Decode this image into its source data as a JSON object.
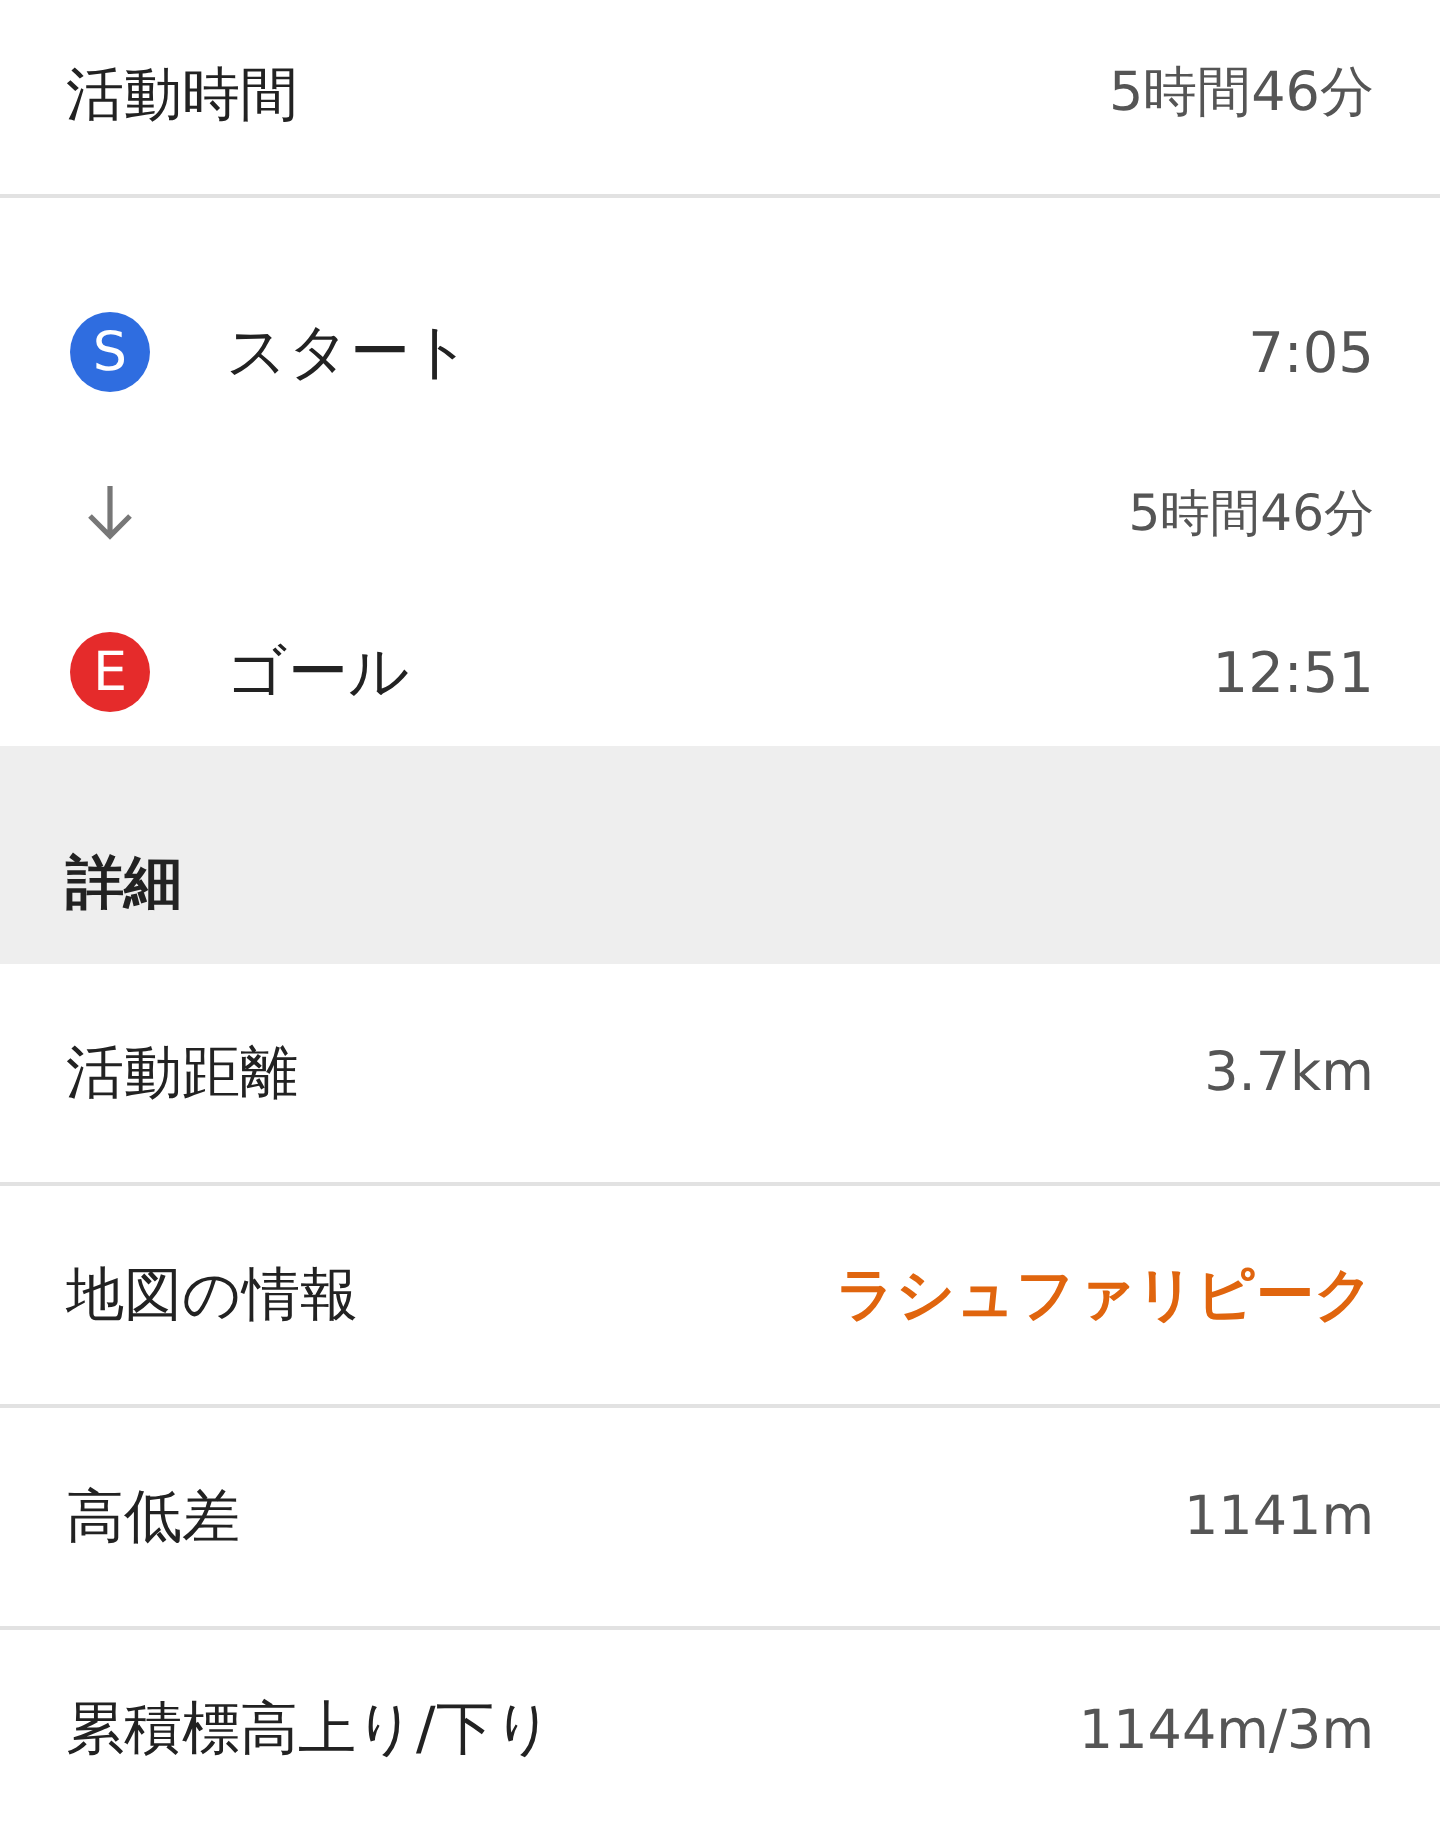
{
  "summary": {
    "label": "活動時間",
    "value": "5時間46分"
  },
  "timeline": [
    {
      "kind": "start",
      "badge": "S",
      "label": "スタート",
      "value": "7:05"
    },
    {
      "kind": "arrow",
      "value": "5時間46分"
    },
    {
      "kind": "end",
      "badge": "E",
      "label": "ゴール",
      "value": "12:51"
    }
  ],
  "section": {
    "title": "詳細"
  },
  "details": [
    {
      "label": "活動距離",
      "value": "3.7km",
      "kind": "plain"
    },
    {
      "label": "地図の情報",
      "value": "ラシュファリピーク",
      "kind": "link"
    },
    {
      "label": "高低差",
      "value": "1141m",
      "kind": "plain"
    },
    {
      "label": "累積標高上り/下り",
      "value": "1144m/3m",
      "kind": "plain"
    }
  ]
}
